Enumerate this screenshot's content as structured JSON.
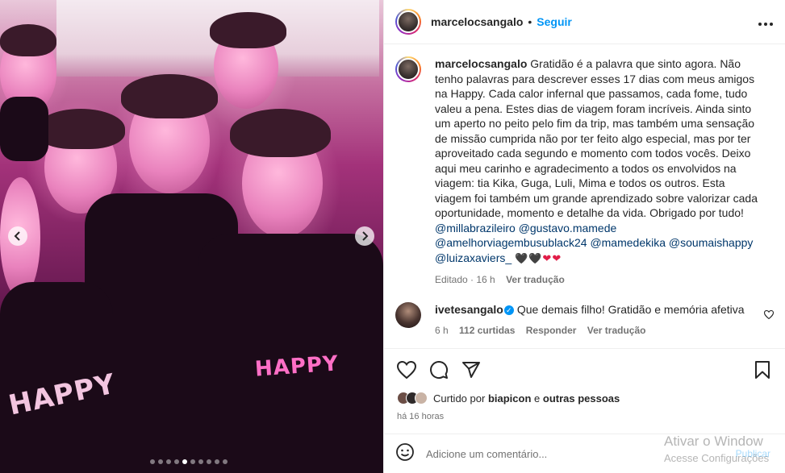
{
  "post": {
    "author": "marcelocsangalo",
    "follow_label": "Seguir",
    "separator": "•",
    "more_icon": "more-icon"
  },
  "caption": {
    "username": "marcelocsangalo",
    "text": "Gratidão é a palavra que sinto agora. Não tenho palavras para descrever esses 17 dias com meus amigos na Happy. Cada calor infernal que passamos, cada fome, tudo valeu a pena. Estes dias de viagem foram incríveis. Ainda sinto um aperto no peito pelo fim da trip, mas também uma sensação de missão cumprida não por ter feito algo especial, mas por ter aproveitado cada segundo e momento com todos vocês. Deixo aqui meu carinho e agradecimento a todos os envolvidos na viagem: tia Kika, Guga, Luli, Mima e todos os outros. Esta viagem foi também um grande aprendizado sobre valorizar cada oportunidade, momento e detalhe da vida. Obrigado por tudo!",
    "mentions": [
      "@millabrazileiro",
      "@gustavo.mamede",
      "@amelhorviagembusublack24",
      "@mamedekika",
      "@soumaishappy",
      "@luizaxaviers_"
    ],
    "hearts": [
      "🖤",
      "🖤",
      "❤",
      "❤"
    ],
    "edited": "Editado",
    "time": "16 h",
    "translate": "Ver tradução"
  },
  "comment": {
    "username": "ivetesangalo",
    "text": "Que demais filho! Gratidão e memória afetiva",
    "time": "6 h",
    "likes": "112 curtidas",
    "reply": "Responder",
    "translate": "Ver tradução"
  },
  "photo": {
    "print_text": "HAPPY",
    "dots_total": 10,
    "dots_active_index": 4
  },
  "liked_by": {
    "prefix": "Curtido por",
    "user": "biapicon",
    "connector": "e",
    "others": "outras pessoas"
  },
  "timestamp": "há 16 horas",
  "add_comment": {
    "placeholder": "Adicione um comentário..."
  },
  "watermark": {
    "line1": "Ativar o Window",
    "line2": "Acesse Configurações",
    "publish": "Publicar"
  }
}
